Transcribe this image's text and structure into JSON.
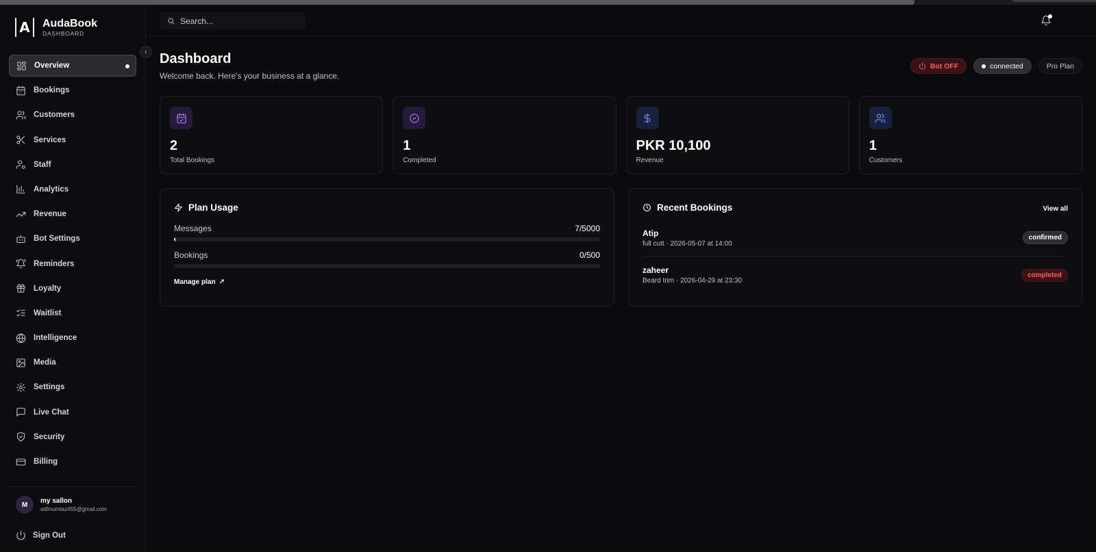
{
  "brand": {
    "name": "AudaBook",
    "subtitle": "DASHBOARD",
    "logo_letter": "A"
  },
  "search": {
    "placeholder": "Search..."
  },
  "sidebar": {
    "items": [
      {
        "label": "Overview",
        "icon": "grid-icon",
        "active": true
      },
      {
        "label": "Bookings",
        "icon": "calendar-icon"
      },
      {
        "label": "Customers",
        "icon": "users-icon"
      },
      {
        "label": "Services",
        "icon": "scissors-icon"
      },
      {
        "label": "Staff",
        "icon": "user-gear-icon"
      },
      {
        "label": "Analytics",
        "icon": "bar-chart-icon"
      },
      {
        "label": "Revenue",
        "icon": "trending-up-icon"
      },
      {
        "label": "Bot Settings",
        "icon": "bot-icon"
      },
      {
        "label": "Reminders",
        "icon": "bell-ring-icon"
      },
      {
        "label": "Loyalty",
        "icon": "gift-icon"
      },
      {
        "label": "Waitlist",
        "icon": "list-checks-icon"
      },
      {
        "label": "Intelligence",
        "icon": "globe-icon"
      },
      {
        "label": "Media",
        "icon": "image-icon"
      },
      {
        "label": "Settings",
        "icon": "gear-icon"
      },
      {
        "label": "Live Chat",
        "icon": "message-icon"
      },
      {
        "label": "Security",
        "icon": "shield-icon"
      },
      {
        "label": "Billing",
        "icon": "credit-card-icon"
      }
    ]
  },
  "user": {
    "initial": "M",
    "name": "my sallon",
    "email": "atifmumtaz455@gmail.com"
  },
  "signout": {
    "label": "Sign Out"
  },
  "header": {
    "title": "Dashboard",
    "subtitle": "Welcome back. Here's your business at a glance.",
    "bot_status": "Bot OFF",
    "connection": "connected",
    "plan": "Pro Plan"
  },
  "stats": [
    {
      "value": "2",
      "label": "Total Bookings",
      "icon": "calendar-check-icon"
    },
    {
      "value": "1",
      "label": "Completed",
      "icon": "check-circle-icon"
    },
    {
      "value": "PKR 10,100",
      "label": "Revenue",
      "icon": "dollar-icon"
    },
    {
      "value": "1",
      "label": "Customers",
      "icon": "users-icon"
    }
  ],
  "plan_usage": {
    "title": "Plan Usage",
    "rows": [
      {
        "label": "Messages",
        "count": "7/5000",
        "fraction": 0.0014
      },
      {
        "label": "Bookings",
        "count": "0/500",
        "fraction": 0
      }
    ],
    "manage_label": "Manage plan",
    "manage_arrow": "↗"
  },
  "recent_bookings": {
    "title": "Recent Bookings",
    "view_all": "View all",
    "items": [
      {
        "name": "Atip",
        "detail": "full cutt · 2026-05-07 at 14:00",
        "status": "confirmed"
      },
      {
        "name": "zaheer",
        "detail": "Beard trim · 2026-04-29 at 23:30",
        "status": "completed"
      }
    ]
  },
  "colors": {
    "background": "#0b0b0d",
    "accent_red": "#f06068",
    "accent_purple": "#a57cf0",
    "accent_blue": "#6e8cf5"
  }
}
